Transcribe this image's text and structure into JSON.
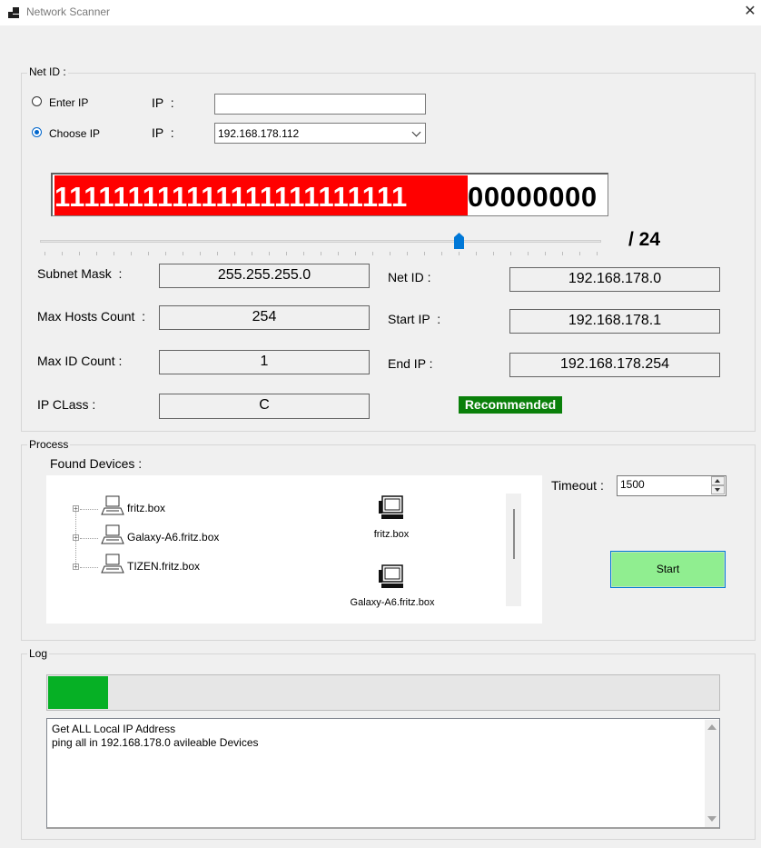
{
  "window": {
    "title": "Network Scanner",
    "close_label": "✕"
  },
  "net_id_group": {
    "label": "Net ID :",
    "enter_ip": {
      "label": "Enter IP",
      "ip_label": "IP  :",
      "value": ""
    },
    "choose_ip": {
      "label": "Choose IP",
      "ip_label": "IP  :",
      "selected": "192.168.178.112"
    },
    "selected_mode": "choose_ip",
    "mask_bits": {
      "ones": "111111111111111111111111",
      "zeros": "00000000"
    },
    "slider": {
      "value": 24,
      "min": 0,
      "max": 32,
      "label": "/ 24"
    },
    "fields": {
      "subnet_mask": {
        "label": "Subnet Mask  :",
        "value": "255.255.255.0"
      },
      "max_hosts": {
        "label": "Max Hosts Count  :",
        "value": "254"
      },
      "max_id": {
        "label": "Max ID Count :",
        "value": "1"
      },
      "ip_class": {
        "label": "IP CLass :",
        "value": "C"
      },
      "net_id": {
        "label": "Net ID :",
        "value": "192.168.178.0"
      },
      "start_ip": {
        "label": "Start IP  :",
        "value": "192.168.178.1"
      },
      "end_ip": {
        "label": "End IP :",
        "value": "192.168.178.254"
      }
    },
    "recommended": "Recommended"
  },
  "process_group": {
    "label": "Process",
    "found_label": "Found Devices :",
    "tree_items": [
      "fritz.box",
      "Galaxy-A6.fritz.box",
      "TIZEN.fritz.box"
    ],
    "icon_items": [
      "fritz.box",
      "Galaxy-A6.fritz.box"
    ],
    "timeout_label": "Timeout :",
    "timeout_value": "1500",
    "start_label": "Start"
  },
  "log_group": {
    "label": "Log",
    "progress": 0.09,
    "progress_color": "#06b025",
    "lines": [
      "Get ALL Local IP Address",
      "ping all in 192.168.178.0 avileable Devices"
    ]
  },
  "colors": {
    "mask_ones_bg": "#ff0000",
    "recommended_bg": "#0a800a",
    "start_bg": "#90ee90"
  }
}
